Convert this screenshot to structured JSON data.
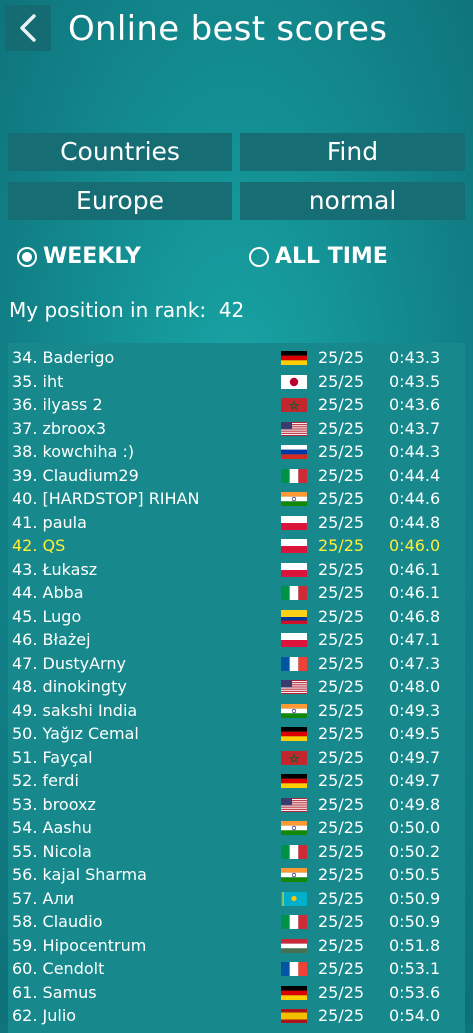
{
  "header": {
    "title": "Online best scores"
  },
  "filters": {
    "countries_label": "Countries",
    "find_label": "Find",
    "region_label": "Europe",
    "difficulty_label": "normal"
  },
  "period": {
    "weekly_label": "WEEKLY",
    "alltime_label": "ALL TIME",
    "selected": "WEEKLY"
  },
  "my_position": {
    "label": "My position in rank:",
    "value": "42"
  },
  "leaderboard": [
    {
      "name": "34. Baderigo",
      "flag": "de",
      "score": "25/25",
      "time": "0:43.3"
    },
    {
      "name": "35. iht",
      "flag": "jp",
      "score": "25/25",
      "time": "0:43.5"
    },
    {
      "name": "36. ilyass 2",
      "flag": "ma",
      "score": "25/25",
      "time": "0:43.6"
    },
    {
      "name": "37. zbroox3",
      "flag": "us",
      "score": "25/25",
      "time": "0:43.7"
    },
    {
      "name": "38. kowchiha :)",
      "flag": "ru",
      "score": "25/25",
      "time": "0:44.3"
    },
    {
      "name": "39. Claudium29",
      "flag": "it",
      "score": "25/25",
      "time": "0:44.4"
    },
    {
      "name": "40. [HARDSTOP] RIHAN",
      "flag": "in",
      "score": "25/25",
      "time": "0:44.6"
    },
    {
      "name": "41. paula",
      "flag": "pl",
      "score": "25/25",
      "time": "0:44.8"
    },
    {
      "name": "42. QS",
      "flag": "pl",
      "score": "25/25",
      "time": "0:46.0",
      "me": true
    },
    {
      "name": "43. Łukasz",
      "flag": "pl",
      "score": "25/25",
      "time": "0:46.1"
    },
    {
      "name": "44. Abba",
      "flag": "it",
      "score": "25/25",
      "time": "0:46.1"
    },
    {
      "name": "45. Lugo",
      "flag": "co",
      "score": "25/25",
      "time": "0:46.8"
    },
    {
      "name": "46. Błażej",
      "flag": "pl",
      "score": "25/25",
      "time": "0:47.1"
    },
    {
      "name": "47. DustyArny",
      "flag": "fr",
      "score": "25/25",
      "time": "0:47.3"
    },
    {
      "name": "48. dinokingty",
      "flag": "us",
      "score": "25/25",
      "time": "0:48.0"
    },
    {
      "name": "49. sakshi India",
      "flag": "in",
      "score": "25/25",
      "time": "0:49.3"
    },
    {
      "name": "50. Yağız Cemal",
      "flag": "de",
      "score": "25/25",
      "time": "0:49.5"
    },
    {
      "name": "51. Fayçal",
      "flag": "ma",
      "score": "25/25",
      "time": "0:49.7"
    },
    {
      "name": "52. ferdi",
      "flag": "de",
      "score": "25/25",
      "time": "0:49.7"
    },
    {
      "name": "53. brooxz",
      "flag": "us",
      "score": "25/25",
      "time": "0:49.8"
    },
    {
      "name": "54. Aashu",
      "flag": "in",
      "score": "25/25",
      "time": "0:50.0"
    },
    {
      "name": "55. Nicola",
      "flag": "it",
      "score": "25/25",
      "time": "0:50.2"
    },
    {
      "name": "56. kajal Sharma",
      "flag": "in",
      "score": "25/25",
      "time": "0:50.5"
    },
    {
      "name": "57. Али",
      "flag": "kz",
      "score": "25/25",
      "time": "0:50.9"
    },
    {
      "name": "58. Claudio",
      "flag": "it",
      "score": "25/25",
      "time": "0:50.9"
    },
    {
      "name": "59. Hipocentrum",
      "flag": "hu",
      "score": "25/25",
      "time": "0:51.8"
    },
    {
      "name": "60. Cendolt",
      "flag": "fr",
      "score": "25/25",
      "time": "0:53.1"
    },
    {
      "name": "61. Samus",
      "flag": "de",
      "score": "25/25",
      "time": "0:53.6"
    },
    {
      "name": "62. Julio",
      "flag": "es",
      "score": "25/25",
      "time": "0:54.0"
    }
  ]
}
